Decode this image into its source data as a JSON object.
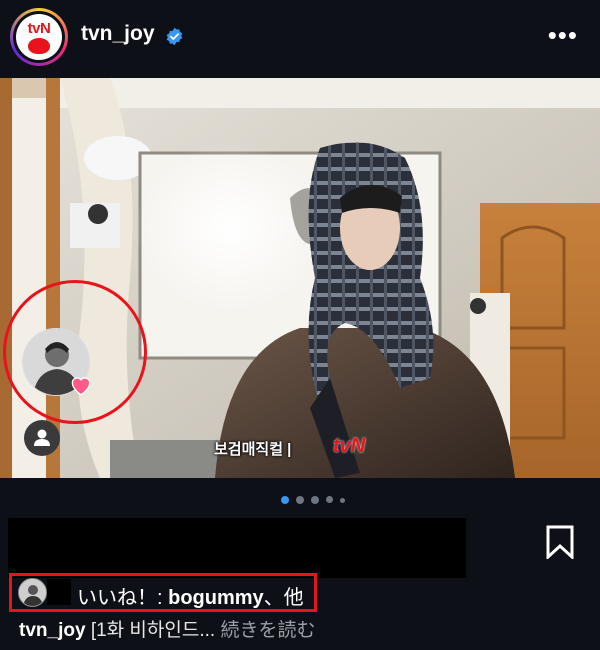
{
  "post": {
    "username": "tvn_joy",
    "verified_icon": "verified-badge-icon",
    "more_icon": "more-options-icon",
    "more_label": "•••",
    "logo_text": "tvN",
    "colors": {
      "brand_red": "#e8141b",
      "verified_blue": "#3897f0",
      "background": "#0d1117"
    }
  },
  "photo": {
    "watermark_title": "보검매직컬 |",
    "watermark_brand": "tvN"
  },
  "carousel": {
    "dot_count": 5,
    "active_index": 0
  },
  "likes": {
    "text_prefix": "いいね！: ",
    "liker": "bogummy",
    "text_suffix": "、他"
  },
  "caption": {
    "user": "tvn_joy",
    "text": "[1화 비하인드...",
    "more": "続きを読む"
  }
}
